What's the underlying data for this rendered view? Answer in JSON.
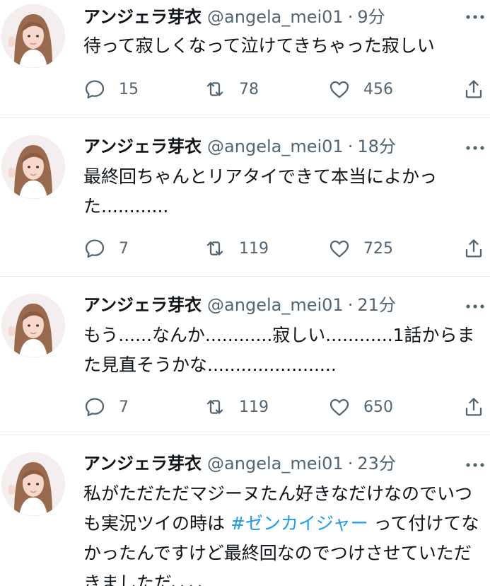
{
  "tweets": [
    {
      "name": "アンジェラ芽衣",
      "handle": "@angela_mei01",
      "separator": "·",
      "time": "9分",
      "text": "待って寂しくなって泣けてきちゃった寂しい",
      "replies": "15",
      "retweets": "78",
      "likes": "456"
    },
    {
      "name": "アンジェラ芽衣",
      "handle": "@angela_mei01",
      "separator": "·",
      "time": "18分",
      "text": "最終回ちゃんとリアタイできて本当によかった............",
      "replies": "7",
      "retweets": "119",
      "likes": "725"
    },
    {
      "name": "アンジェラ芽衣",
      "handle": "@angela_mei01",
      "separator": "·",
      "time": "21分",
      "text": "もう......なんか............寂しい............1話からまた見直そうかな.......................",
      "replies": "7",
      "retweets": "119",
      "likes": "650"
    },
    {
      "name": "アンジェラ芽衣",
      "handle": "@angela_mei01",
      "separator": "·",
      "time": "23分",
      "text_before": "私がただただマジーヌたん好きなだけなのでいつも実況ツイの時は ",
      "hashtag": "#ゼンカイジャー",
      "text_after": " って付けてなかったんですけど最終回なのでつけさせていただきましただ、、、、"
    }
  ],
  "colors": {
    "text": "#0f1419",
    "secondary": "#536471",
    "link": "#1d9bf0",
    "divider": "#e6ecf0"
  },
  "icons": [
    "reply-icon",
    "retweet-icon",
    "like-icon",
    "share-icon",
    "more-icon"
  ]
}
